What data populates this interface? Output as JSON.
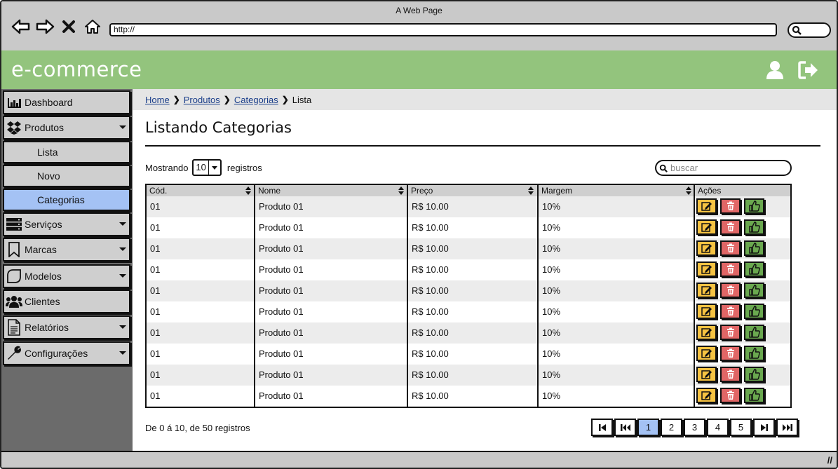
{
  "window": {
    "title": "A Web Page",
    "url": "http://"
  },
  "app": {
    "brand": "e-commerce"
  },
  "sidebar": {
    "items": [
      {
        "label": "Dashboard",
        "icon": "bar-chart-icon"
      },
      {
        "label": "Produtos",
        "icon": "dropbox-icon",
        "expanded": true,
        "children": [
          {
            "label": "Lista"
          },
          {
            "label": "Novo"
          },
          {
            "label": "Categorias",
            "active": true
          }
        ]
      },
      {
        "label": "Serviços",
        "icon": "server-icon"
      },
      {
        "label": "Marcas",
        "icon": "bookmark-icon"
      },
      {
        "label": "Modelos",
        "icon": "leaf-icon"
      },
      {
        "label": "Clientes",
        "icon": "users-icon"
      },
      {
        "label": "Relatórios",
        "icon": "document-icon"
      },
      {
        "label": "Configurações",
        "icon": "wrench-icon"
      }
    ]
  },
  "breadcrumb": {
    "items": [
      "Home",
      "Produtos",
      "Categorias"
    ],
    "current": "Lista"
  },
  "page": {
    "title": "Listando Categorias",
    "showing_prefix": "Mostrando",
    "page_size": "10",
    "showing_suffix": "registros",
    "search_placeholder": "buscar",
    "summary": "De 0 á 10, de 50 registros"
  },
  "table": {
    "headers": [
      "Cód.",
      "Nome",
      "Preço",
      "Margem",
      "Ações"
    ],
    "rows": [
      [
        "01",
        "Produto 01",
        "R$ 10.00",
        "10%"
      ],
      [
        "01",
        "Produto 01",
        "R$ 10.00",
        "10%"
      ],
      [
        "01",
        "Produto 01",
        "R$ 10.00",
        "10%"
      ],
      [
        "01",
        "Produto 01",
        "R$ 10.00",
        "10%"
      ],
      [
        "01",
        "Produto 01",
        "R$ 10.00",
        "10%"
      ],
      [
        "01",
        "Produto 01",
        "R$ 10.00",
        "10%"
      ],
      [
        "01",
        "Produto 01",
        "R$ 10.00",
        "10%"
      ],
      [
        "01",
        "Produto 01",
        "R$ 10.00",
        "10%"
      ],
      [
        "01",
        "Produto 01",
        "R$ 10.00",
        "10%"
      ],
      [
        "01",
        "Produto 01",
        "R$ 10.00",
        "10%"
      ]
    ]
  },
  "pagination": {
    "pages": [
      "1",
      "2",
      "3",
      "4",
      "5"
    ],
    "current": "1"
  },
  "colors": {
    "header_green": "#93c47d",
    "active_blue": "#a4c2f4",
    "edit_yellow": "#f6c342",
    "delete_red": "#e06666",
    "approve_green": "#6aa84f"
  }
}
